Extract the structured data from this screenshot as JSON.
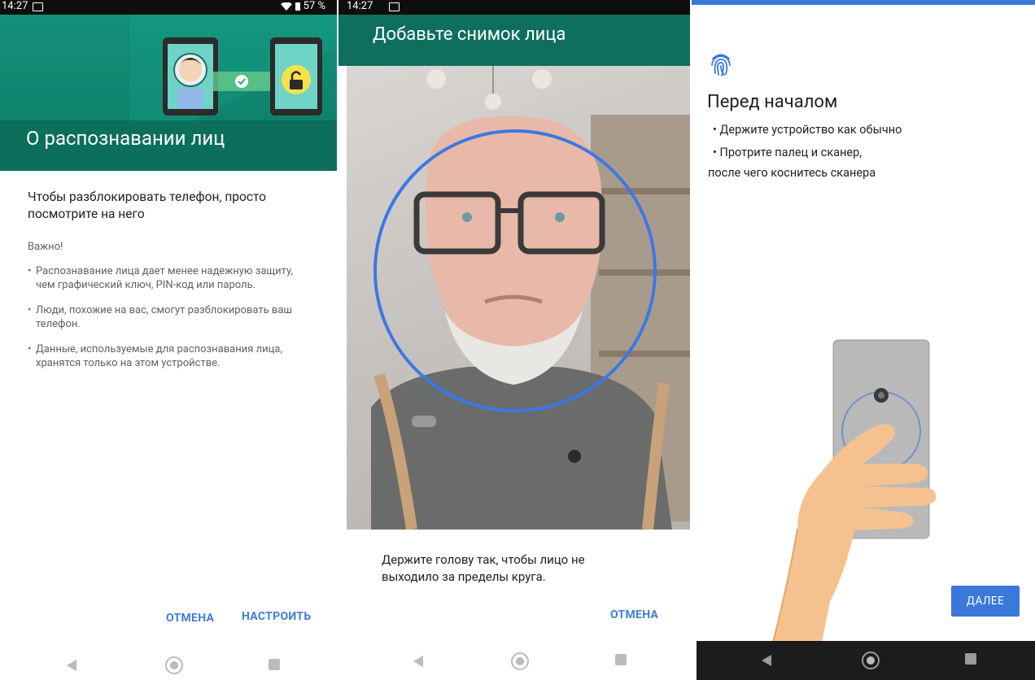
{
  "panel1": {
    "status": {
      "time": "14:27",
      "battery": "57 %"
    },
    "title": "О распознавании лиц",
    "lead": "Чтобы разблокировать телефон, просто посмотрите на него",
    "important": "Важно!",
    "bullets": [
      "Распознавание лица дает менее надежную защиту, чем графический ключ, PIN-код или пароль.",
      "Люди, похожие на вас, смогут разблокировать ваш телефон.",
      "Данные, используемые для распознавания лица, хранятся только на этом устройстве."
    ],
    "cancel": "ОТМЕНА",
    "setup": "НАСТРОИТЬ"
  },
  "panel2": {
    "status": {
      "time": "14:27"
    },
    "title": "Добавьте снимок лица",
    "caption": "Держите голову так, чтобы лицо не выходило за пределы круга.",
    "cancel": "ОТМЕНА"
  },
  "panel3": {
    "title": "Перед началом",
    "items": [
      "• Держите устройство как обычно",
      "• Протрите палец и сканер,",
      "после чего коснитесь сканера"
    ],
    "next": "ДАЛЕЕ"
  },
  "colors": {
    "accent": "#3f7fd9",
    "teal": "#0e6f5e",
    "circle": "#3c78e6"
  }
}
